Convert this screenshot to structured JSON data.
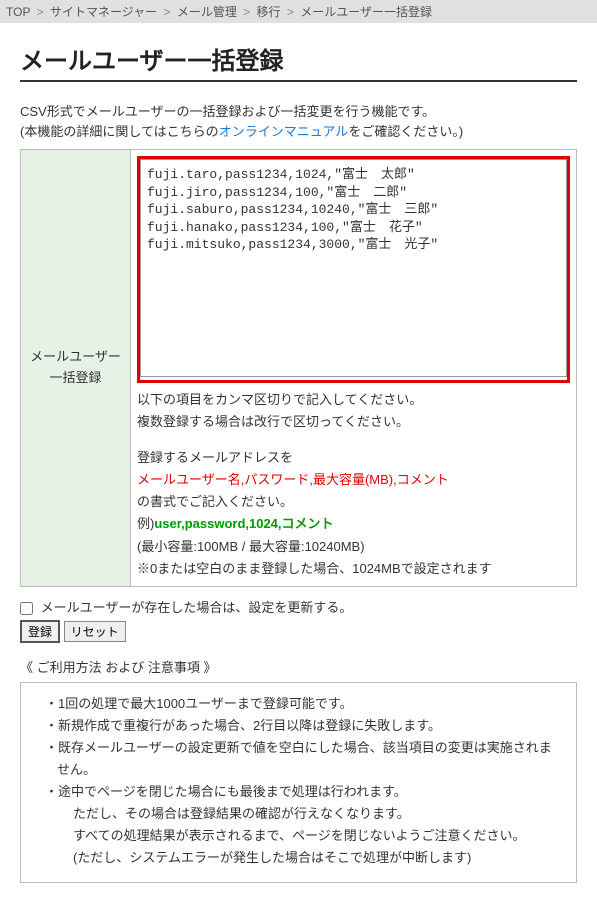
{
  "breadcrumb": {
    "items": [
      "TOP",
      "サイトマネージャー",
      "メール管理",
      "移行",
      "メールユーザー一括登録"
    ],
    "sep": ">"
  },
  "page_title": "メールユーザー一括登録",
  "description": {
    "line1": "CSV形式でメールユーザーの一括登録および一括変更を行う機能です。",
    "line2a": "(本機能の詳細に関してはこちらの",
    "manual_link": "オンラインマニュアル",
    "line2b": "をご確認ください。)"
  },
  "form": {
    "label_l1": "メールユーザー",
    "label_l2": "一括登録",
    "csv_value": "fuji.taro,pass1234,1024,\"富士　太郎\"\nfuji.jiro,pass1234,100,\"富士　二郎\"\nfuji.saburo,pass1234,10240,\"富士　三郎\"\nfuji.hanako,pass1234,100,\"富士　花子\"\nfuji.mitsuko,pass1234,3000,\"富士　光子\"",
    "help": {
      "p1": "以下の項目をカンマ区切りで記入してください。",
      "p2": "複数登録する場合は改行で区切ってください。",
      "p3": "登録するメールアドレスを",
      "p4": "メールユーザー名,パスワード,最大容量(MB),コメント",
      "p5": "の書式でご記入ください。",
      "p6a": "例)",
      "p6b": "user,password,1024,コメント",
      "p7": "(最小容量:100MB / 最大容量:10240MB)",
      "p8": "※0または空白のまま登録した場合、1024MBで設定されます"
    }
  },
  "controls": {
    "checkbox_label": "メールユーザーが存在した場合は、設定を更新する。",
    "submit_label": "登録",
    "reset_label": "リセット"
  },
  "notes": {
    "title": "《 ご利用方法 および 注意事項 》",
    "items": [
      "1回の処理で最大1000ユーザーまで登録可能です。",
      "新規作成で重複行があった場合、2行目以降は登録に失敗します。",
      "既存メールユーザーの設定更新で値を空白にした場合、該当項目の変更は実施されません。",
      "途中でページを閉じた場合にも最後まで処理は行われます。"
    ],
    "indents": [
      "ただし、その場合は登録結果の確認が行えなくなります。",
      "すべての処理結果が表示されるまで、ページを閉じないようご注意ください。",
      "(ただし、システムエラーが発生した場合はそこで処理が中断します)"
    ]
  }
}
